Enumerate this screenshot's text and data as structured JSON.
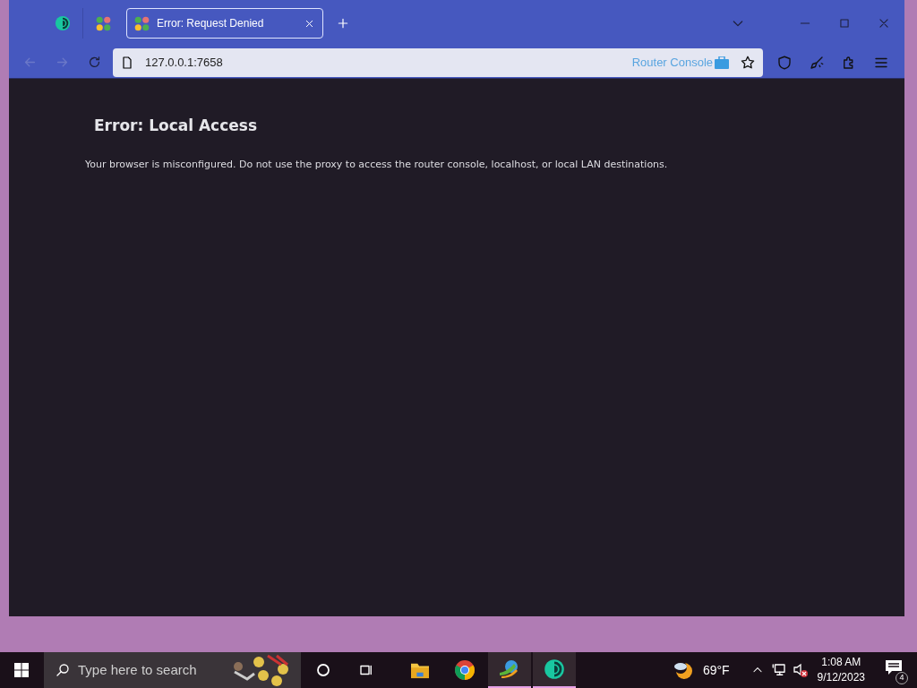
{
  "browser": {
    "tabs": [
      {
        "kind": "onion",
        "selected": false
      },
      {
        "kind": "dots",
        "selected": false
      },
      {
        "kind": "dots",
        "title": "Error: Request Denied",
        "selected": true
      }
    ],
    "url": "127.0.0.1:7658",
    "address_badge": "Router Console"
  },
  "page": {
    "heading": "Error: Local Access",
    "message": "Your browser is misconfigured. Do not use the proxy to access the router console, localhost, or local LAN destinations."
  },
  "taskbar": {
    "search": {
      "placeholder": "Type here to search"
    },
    "apps": [
      {
        "kind": "folder",
        "running": false
      },
      {
        "kind": "chrome",
        "running": false
      },
      {
        "kind": "download",
        "running": true
      },
      {
        "kind": "onion",
        "running": true
      }
    ],
    "weather": "69°F",
    "time": "1:08 AM",
    "date": "9/12/2023",
    "notifications": "4"
  }
}
